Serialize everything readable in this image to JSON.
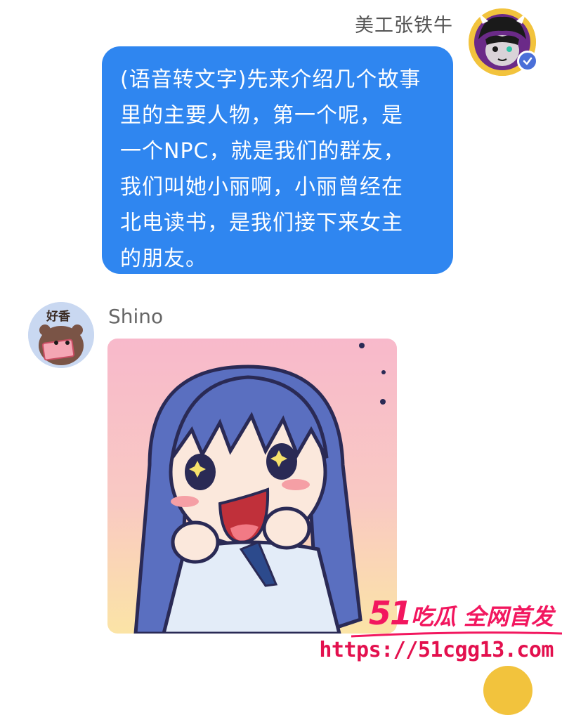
{
  "colors": {
    "bubble_blue": "#2f86f0",
    "sender_gray": "#666666",
    "watermark_red": "#f2175f"
  },
  "messages": {
    "outgoing": {
      "sender": "美工张铁牛",
      "text": "(语音转文字)先来介绍几个故事\n里的主要人物，第一个呢，是\n一个NPC，就是我们的群友，\n我们叫她小丽啊，小丽曾经在\n北电读书，是我们接下来女主\n的朋友。",
      "avatar_icon": "anime-character-avatar-icon",
      "badge_icon": "verified-check-icon"
    },
    "incoming": {
      "sender": "Shino",
      "avatar_text": "好香",
      "avatar_icon": "bear-holding-cash-avatar-icon",
      "sticker_icon": "excited-anime-girl-sticker"
    }
  },
  "watermark": {
    "logo_num": "51",
    "logo_text": "吃瓜 全网首发",
    "url": "https://51cgg13.com"
  }
}
